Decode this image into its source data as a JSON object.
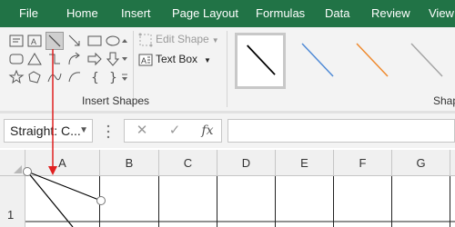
{
  "tabs": [
    "File",
    "Home",
    "Insert",
    "Page Layout",
    "Formulas",
    "Data",
    "Review",
    "View"
  ],
  "ribbon": {
    "insert_shapes_label": "Insert Shapes",
    "edit_shape_label": "Edit Shape",
    "text_box_label": "Text Box",
    "shape_styles_label": "Shap",
    "selected_shape": "line"
  },
  "formula_bar": {
    "name_box": "Straight: C...",
    "cancel": "✕",
    "enter": "✓",
    "fx": "fx",
    "formula": ""
  },
  "sheet": {
    "columns": [
      "A",
      "B",
      "C",
      "D",
      "E",
      "F",
      "G"
    ],
    "rows": [
      "1"
    ]
  },
  "colors": {
    "ribbon_green": "#217346",
    "arrow_red": "#e02020",
    "style_lines": [
      "#000000",
      "#4f8ad6",
      "#ef8a2e",
      "#a5a5a5"
    ]
  }
}
